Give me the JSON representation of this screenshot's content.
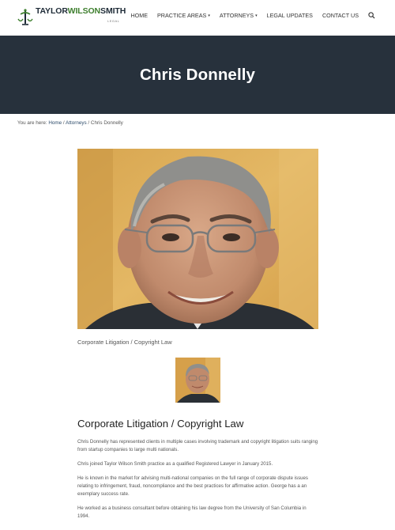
{
  "header": {
    "logo": {
      "name_part1": "TAYLOR",
      "name_part2": "WILSON",
      "name_part3": "SMITH",
      "tagline": "LEGAL"
    },
    "nav": [
      {
        "label": "HOME",
        "has_dropdown": false
      },
      {
        "label": "PRACTICE AREAS",
        "has_dropdown": true
      },
      {
        "label": "ATTORNEYS",
        "has_dropdown": true
      },
      {
        "label": "LEGAL UPDATES",
        "has_dropdown": false
      },
      {
        "label": "CONTACT US",
        "has_dropdown": false
      }
    ],
    "search_icon": "search-icon"
  },
  "hero": {
    "title": "Chris Donnelly"
  },
  "breadcrumb": {
    "prefix": "You are here: ",
    "home": "Home",
    "sep": " / ",
    "attorneys": "Attorneys",
    "current": "Chris Donnelly"
  },
  "profile": {
    "caption": "Corporate Litigation / Copyright Law",
    "heading": "Corporate Litigation / Copyright Law",
    "paragraphs": [
      "Chris Donnelly has represented clients in multiple cases involving trademark and copyright litigation suits ranging from startup companies to large multi nationals.",
      "Chris joined Taylor Wilson Smith practice as a qualified Registered Lawyer in January 2015.",
      "He is known in the market for advising multi-national companies on the full range of corporate dispute issues relating to infringement, fraud, noncompliance and the best practices for affirmative action. George has a an exemplary success rate.",
      "He worked as a business consultant before obtaining his law degree from the University of San Columbia in 1994."
    ]
  },
  "colors": {
    "hero_bg": "#27313c",
    "logo_green": "#3e7f2e",
    "logo_dark": "#1e2b37",
    "link": "#2d4b6a"
  }
}
